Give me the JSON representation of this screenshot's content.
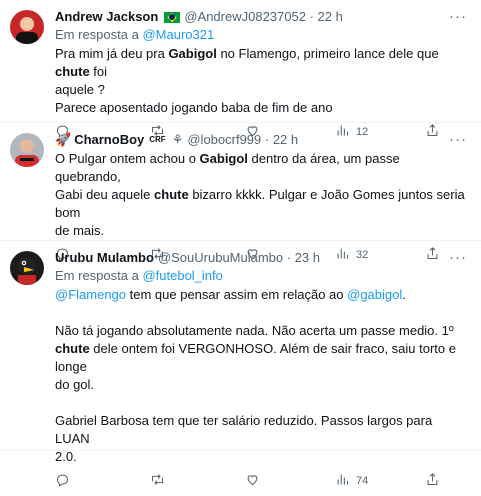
{
  "tweets": [
    {
      "name": "Andrew Jackson",
      "handle": "@AndrewJ08237052",
      "time": "22 h",
      "reply_prefix": "Em resposta a",
      "reply_to": "@Mauro321",
      "lines": [
        [
          "Pra mim já deu pra ",
          {
            "b": "Gabigol"
          },
          " no Flamengo, primeiro lance dele que ",
          {
            "b": "chute"
          },
          " foi"
        ],
        [
          "aquele ?"
        ],
        [
          "Parece aposentado jogando baba de fim de ano"
        ]
      ],
      "likes": "12"
    },
    {
      "name": "CharnoBoy",
      "name_badge": "CRF",
      "handle": "@lobocrf999",
      "time": "22 h",
      "lines": [
        [
          "O Pulgar ontem achou o ",
          {
            "b": "Gabigol"
          },
          " dentro da área, um passe quebrando,"
        ],
        [
          "Gabi deu aquele ",
          {
            "b": "chute"
          },
          " bizarro kkkk. Pulgar e João Gomes juntos seria bom"
        ],
        [
          "de mais."
        ]
      ],
      "likes": "32"
    },
    {
      "name": "Urubu Mulambo",
      "handle": "@SouUrubuMulambo",
      "time": "23 h",
      "reply_prefix": "Em resposta a",
      "reply_to": "@futebol_info",
      "lines": [
        [
          {
            "l": "@Flamengo"
          },
          "  tem que pensar assim em relação ao ",
          {
            "l": "@gabigol"
          },
          "."
        ],
        [
          ""
        ],
        [
          "Não tá jogando absolutamente nada.  Não acerta um passe medio. 1º"
        ],
        [
          {
            "b": "chute"
          },
          " dele ontem foi VERGONHOSO. Além de sair fraco, saiu torto e longe"
        ],
        [
          "do gol."
        ],
        [
          ""
        ],
        [
          "Gabriel Barbosa tem que ter salário reduzido. Passos largos para LUAN"
        ],
        [
          "2.0."
        ]
      ],
      "likes": "74"
    }
  ]
}
